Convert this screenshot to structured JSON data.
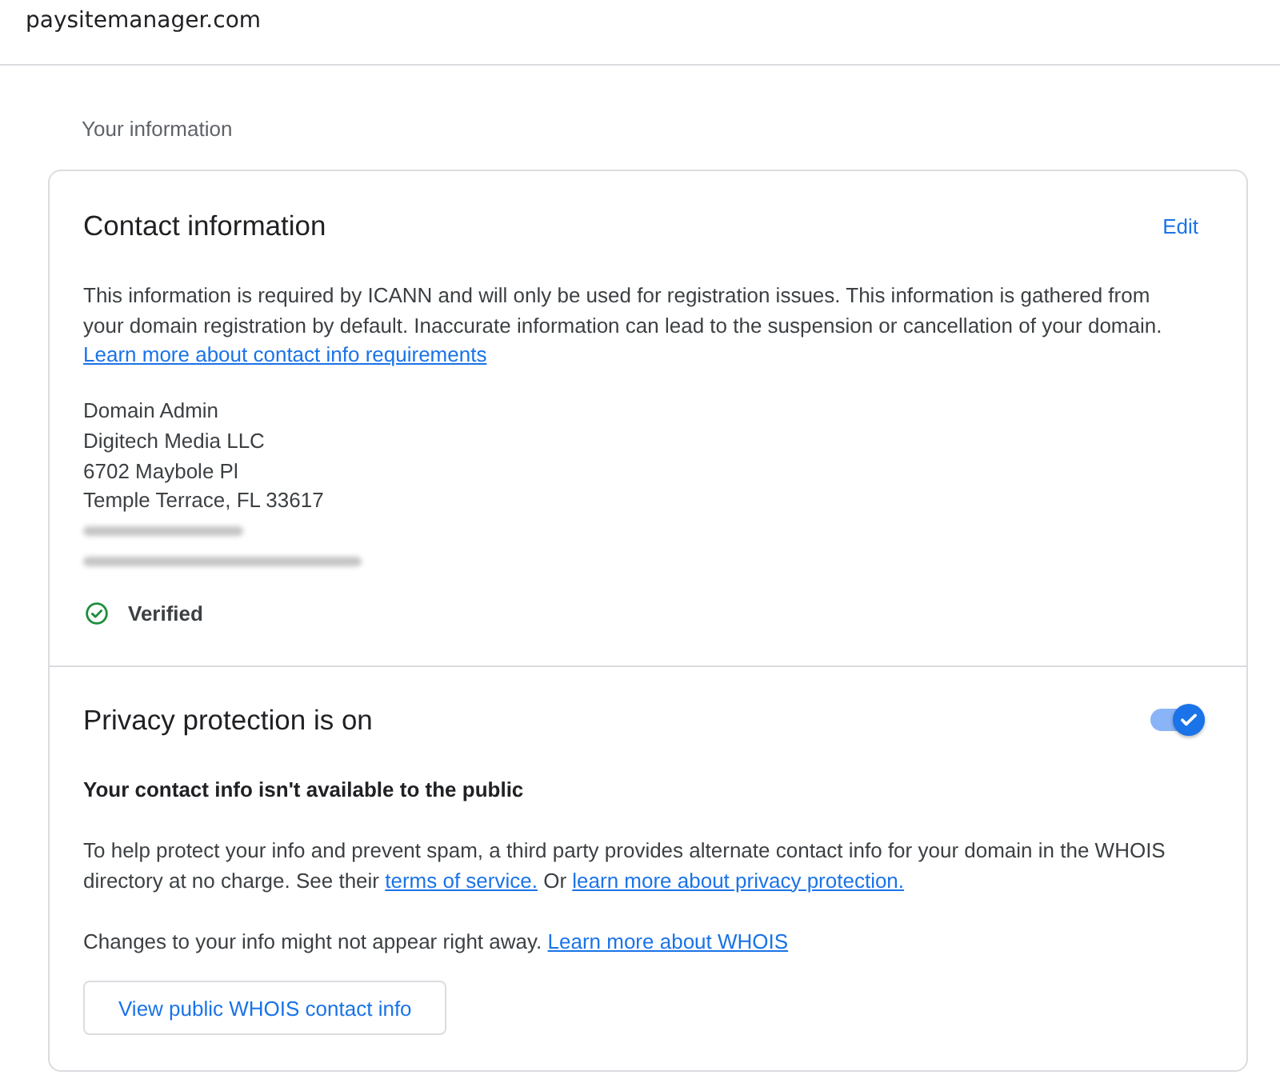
{
  "header": {
    "site": "paysitemanager.com"
  },
  "section_title": "Your information",
  "contact": {
    "title": "Contact information",
    "edit_label": "Edit",
    "description": [
      {
        "kind": "text",
        "text": "This information is required by ICANN and will only be used for registration issues. This information is gathered from your domain registration by default. Inaccurate information can lead to the suspension or cancellation of your domain. "
      },
      {
        "kind": "link",
        "text": "Learn more about contact info requirements"
      }
    ],
    "address_lines": [
      "Domain Admin",
      "Digitech Media LLC",
      "6702 Maybole Pl",
      "Temple Terrace, FL 33617"
    ],
    "status": {
      "label": "Verified",
      "verified": true
    }
  },
  "privacy": {
    "title": "Privacy protection is on",
    "on": true,
    "subtitle": "Your contact info isn't available to the public",
    "paragraphs": [
      [
        {
          "kind": "text",
          "text": "To help protect your info and prevent spam, a third party provides alternate contact info for your domain in the WHOIS directory at no charge. See their "
        },
        {
          "kind": "link",
          "text": "terms of service."
        },
        {
          "kind": "text",
          "text": " Or "
        },
        {
          "kind": "link",
          "text": "learn more about privacy protection."
        }
      ],
      [
        {
          "kind": "text",
          "text": "Changes to your info might not appear right away. "
        },
        {
          "kind": "link",
          "text": "Learn more about WHOIS"
        }
      ]
    ],
    "button_label": "View public WHOIS contact info"
  }
}
